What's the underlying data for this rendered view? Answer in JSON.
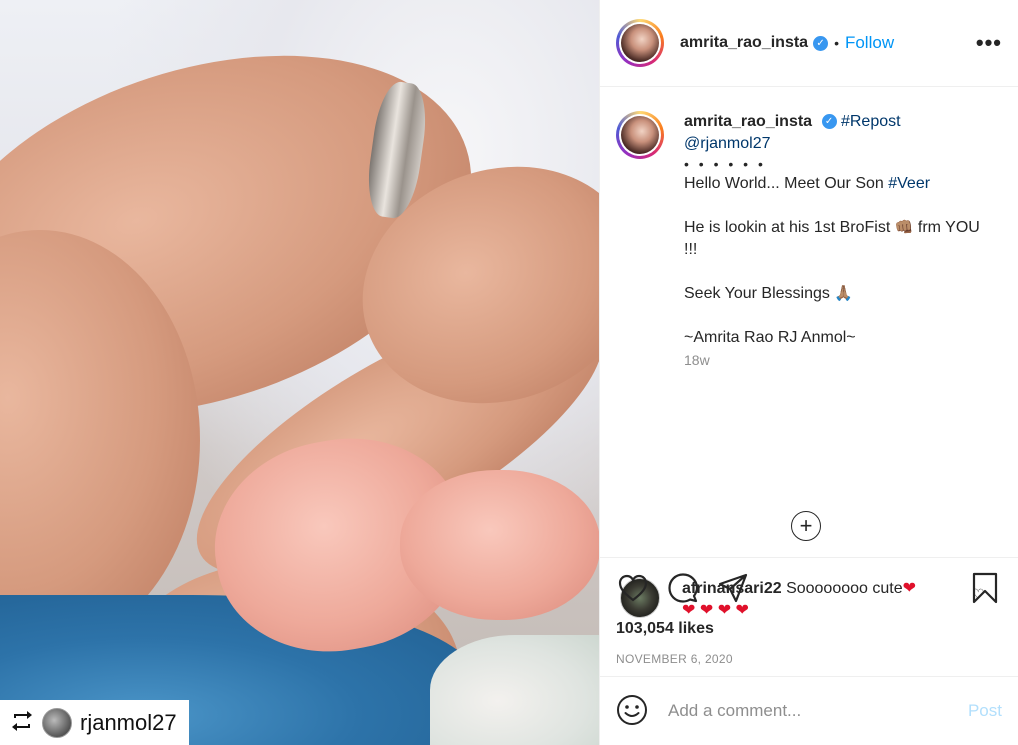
{
  "photo": {
    "repost_icon": "repost-icon",
    "repost_username": "rjanmol27"
  },
  "header": {
    "username": "amrita_rao_insta",
    "separator": "•",
    "follow_label": "Follow",
    "more_label": "•••"
  },
  "caption": {
    "username": "amrita_rao_insta",
    "hashtag_repost": "#Repost",
    "mention": "@rjanmol27",
    "bullets": "• • • • • •",
    "line1_text": "Hello World... Meet Our Son ",
    "line1_hashtag": "#Veer",
    "line2_text": "He is lookin at his 1st BroFist ",
    "line2_emoji": "👊🏽",
    "line2_tail": " frm YOU !!!",
    "line3_text": "Seek Your Blessings ",
    "line3_emoji": "🙏🏽",
    "line4_text": "~Amrita Rao RJ Anmol~",
    "time": "18w"
  },
  "load_more": {
    "label": "+"
  },
  "comment": {
    "username": "afrinansari22",
    "text": "Soooooooo cute",
    "hearts_inline": "❤",
    "hearts_row": "❤ ❤ ❤ ❤",
    "like_icon": "♡"
  },
  "actions": {
    "likes": "103,054 likes",
    "date": "NOVEMBER 6, 2020"
  },
  "add_comment": {
    "placeholder": "Add a comment...",
    "post_label": "Post"
  },
  "colors": {
    "link": "#00376b",
    "follow": "#0095f6",
    "post_disabled": "#b2dffc",
    "muted": "#8e8e8e"
  }
}
